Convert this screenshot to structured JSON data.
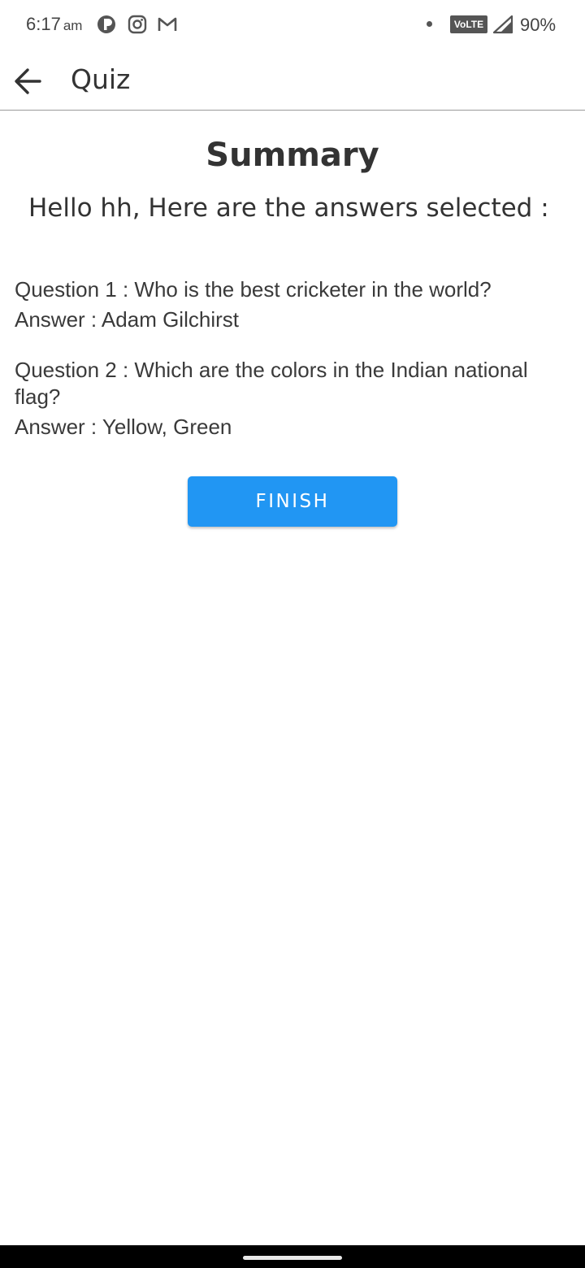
{
  "status_bar": {
    "time": "6:17",
    "ampm": "am",
    "notification_icons": [
      "p-badge-icon",
      "instagram-icon",
      "gmail-icon"
    ],
    "network_badge": "VoLTE",
    "battery": "90%"
  },
  "app_bar": {
    "back_icon": "arrow-left-icon",
    "title": "Quiz"
  },
  "summary": {
    "title": "Summary",
    "greeting": "Hello hh, Here are the answers selected :",
    "items": [
      {
        "question": "Question 1 : Who is the best cricketer in the world?",
        "answer": "Answer : Adam Gilchirst"
      },
      {
        "question": "Question 2 : Which are the colors in the Indian national flag?",
        "answer": "Answer : Yellow, Green"
      }
    ],
    "finish_label": "FINISH"
  },
  "colors": {
    "accent": "#2196f3",
    "text": "#333333",
    "divider": "#9a9a9a"
  }
}
